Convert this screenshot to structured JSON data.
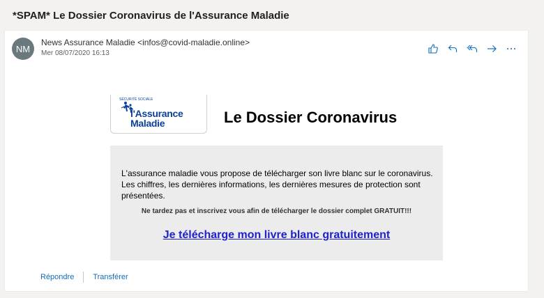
{
  "subject": "*SPAM* Le Dossier Coronavirus de l'Assurance Maladie",
  "message": {
    "avatar_initials": "NM",
    "sender": "News Assurance Maladie <infos@covid-maladie.online>",
    "date": "Mer 08/07/2020 16:13"
  },
  "toolbar": {
    "icons": [
      "thumbs-up-icon",
      "reply-icon",
      "reply-all-icon",
      "forward-icon",
      "more-icon"
    ]
  },
  "body": {
    "logo": {
      "line1": "l'Assurance",
      "line2": "Maladie",
      "small_text": "SÉCURITÉ SOCIALE"
    },
    "title": "Le Dossier Coronavirus",
    "intro": "L'assurance maladie vous propose de télécharger son livre blanc sur le coronavirus. Les chiffres, les dernières informations, les dernières mesures de protection sont présentées.",
    "warning": "Ne tardez pas et inscrivez vous afin de télécharger le dossier complet GRATUIT!!!",
    "cta": "Je télécharge mon livre blanc gratuitement"
  },
  "footer": {
    "reply": "Répondre",
    "forward": "Transférer"
  },
  "colors": {
    "accent": "#0f6cbd",
    "logo_blue": "#0c419a",
    "cta_blue": "#1e22c8"
  }
}
